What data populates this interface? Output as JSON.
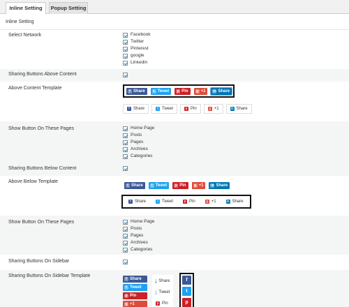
{
  "tabs": [
    {
      "label": "Inline Setting",
      "active": true
    },
    {
      "label": "Popup Setting",
      "active": false
    }
  ],
  "section_title": "Inline Setting",
  "rows": {
    "select_network": {
      "label": "Select Network",
      "options": [
        "Facebook",
        "Twitter",
        "Pinterest",
        "google",
        "Linkedin"
      ]
    },
    "sharing_above": {
      "label": "Sharing Buttons Above Content"
    },
    "above_template": {
      "label": "Above Content Template"
    },
    "show_pages_1": {
      "label": "Show Button On These Pages",
      "options": [
        "Home Page",
        "Posts",
        "Pages",
        "Archives",
        "Categories"
      ]
    },
    "sharing_below": {
      "label": "Sharing Buttons Below Content"
    },
    "below_template": {
      "label": "Above Below Template"
    },
    "show_pages_2": {
      "label": "Show Button On These Pages",
      "options": [
        "Home Page",
        "Posts",
        "Pages",
        "Archives",
        "Categories"
      ]
    },
    "sharing_sidebar": {
      "label": "Sharing Buttons On Sidebar"
    },
    "sidebar_template": {
      "label": "Sharing Buttons On Sidebar Template"
    }
  },
  "buttons": {
    "facebook": "Share",
    "twitter": "Tweet",
    "pinterest": "Pin",
    "google": "+1",
    "linkedin": "Share"
  },
  "icons": {
    "facebook": "f",
    "twitter": "t",
    "pinterest": "p",
    "google": "g",
    "linkedin": "in"
  },
  "colors": {
    "facebook": "#3b5998",
    "twitter": "#1da1f2",
    "pinterest": "#cb2027",
    "google": "#dd4b39",
    "linkedin": "#0077b5",
    "checkmark": "#1e8cbe"
  }
}
